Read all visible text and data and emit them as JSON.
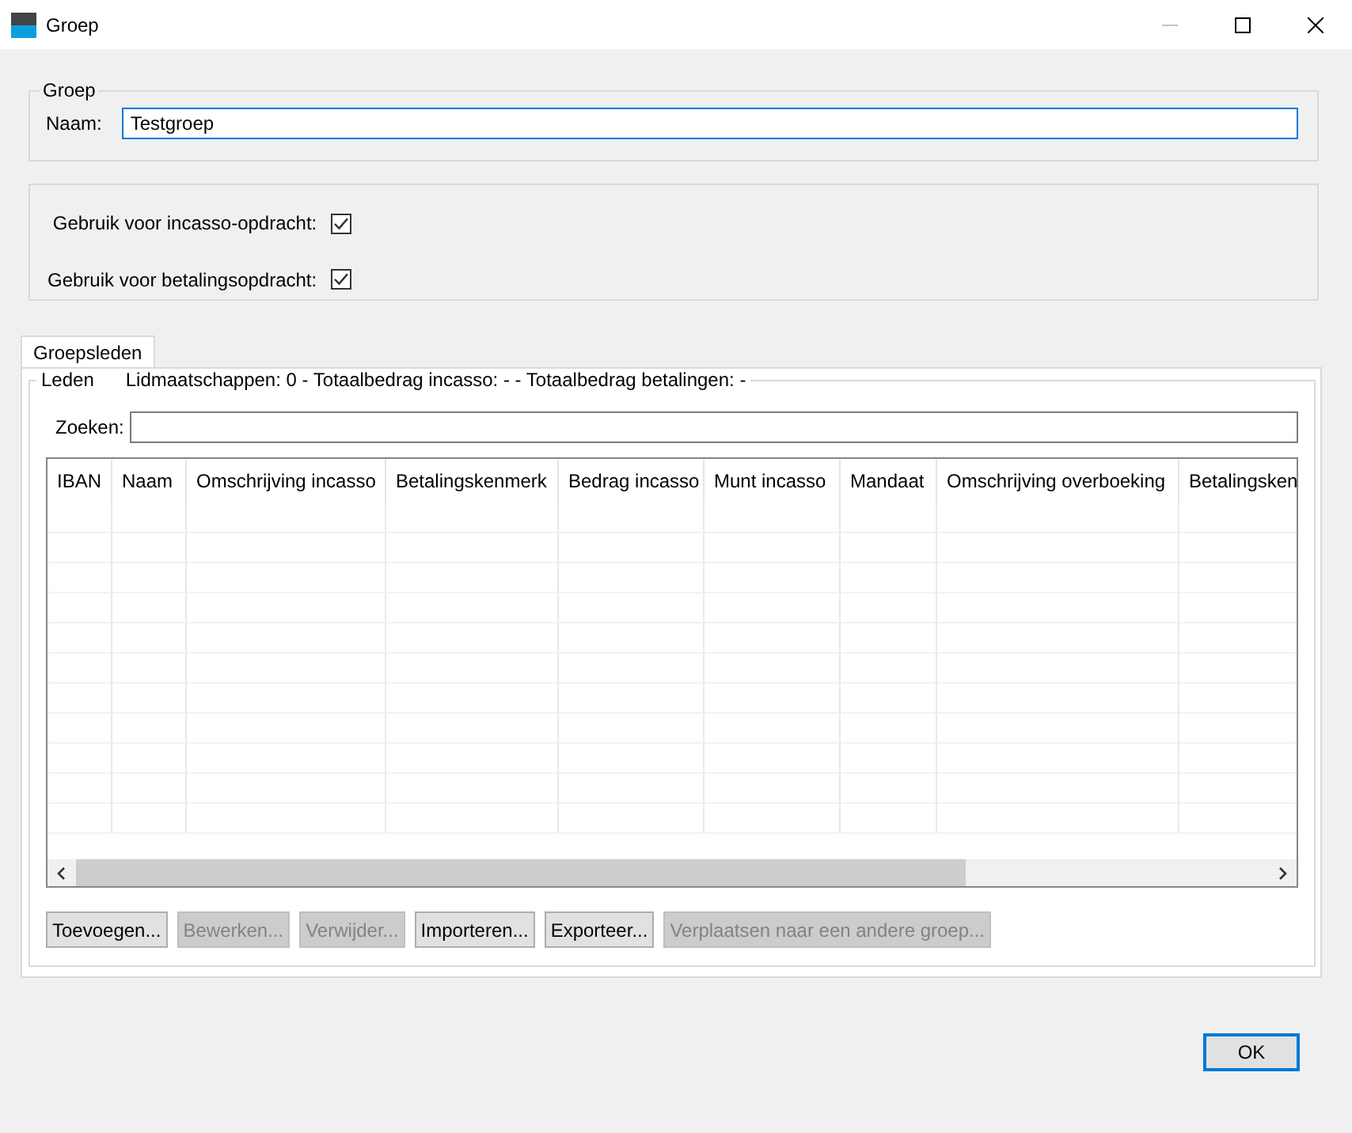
{
  "window": {
    "title": "Groep",
    "controls": [
      {
        "kind": "minimize",
        "disabled": true
      },
      {
        "kind": "maximize",
        "disabled": false
      },
      {
        "kind": "close",
        "disabled": false
      }
    ]
  },
  "group": {
    "legend": "Groep",
    "name_label": "Naam:",
    "name_value": "Testgroep"
  },
  "options": [
    {
      "label": "Gebruik voor incasso-opdracht:",
      "checked": true
    },
    {
      "label": "Gebruik voor betalingsopdracht:",
      "checked": true
    }
  ],
  "tabs": [
    {
      "label": "Groepsleden",
      "selected": true
    }
  ],
  "members": {
    "legend": "Leden",
    "summary": "Lidmaatschappen: 0 - Totaalbedrag incasso: - - Totaalbedrag betalingen: -",
    "search_label": "Zoeken:",
    "table": {
      "columns": [
        "IBAN",
        "Naam",
        "Omschrijving incasso",
        "Betalingskenmerk",
        "Bedrag incasso",
        "Munt incasso",
        "Mandaat",
        "Omschrijving overboeking",
        "Betalingsken"
      ]
    },
    "buttons": [
      {
        "label": "Toevoegen...",
        "disabled": false
      },
      {
        "label": "Bewerken...",
        "disabled": true
      },
      {
        "label": "Verwijder...",
        "disabled": true
      },
      {
        "label": "Importeren...",
        "disabled": false
      },
      {
        "label": "Exporteer...",
        "disabled": false
      },
      {
        "label": "Verplaatsen naar een andere groep...",
        "disabled": true
      }
    ]
  },
  "buttons": [
    {
      "label": "OK"
    }
  ]
}
